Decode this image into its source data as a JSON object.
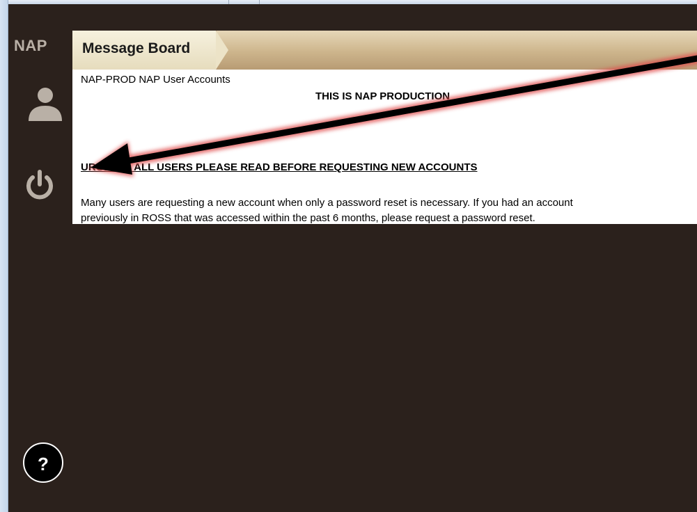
{
  "app": {
    "brand": "NAP"
  },
  "nav": {
    "user_icon": "user-icon",
    "power_icon": "power-icon",
    "help_label": "?"
  },
  "tabs": [
    {
      "label": "Message Board",
      "active": true
    }
  ],
  "message_board": {
    "header": "NAP-PROD NAP User Accounts",
    "banner": "THIS IS NAP PRODUCTION",
    "urgent": "URGENT - ALL USERS PLEASE READ BEFORE REQUESTING NEW ACCOUNTS",
    "body_line1": "Many users are requesting a new account when only a password reset is necessary.  If you had an account",
    "body_line2": "previously in ROSS that was accessed within the past 6 months, please request a password reset."
  },
  "colors": {
    "background": "#2b211c",
    "tab_bar": "#cdb58c",
    "active_tab": "#f6f1de",
    "annotation_arrow": "#000000",
    "annotation_glow": "#e05050"
  }
}
